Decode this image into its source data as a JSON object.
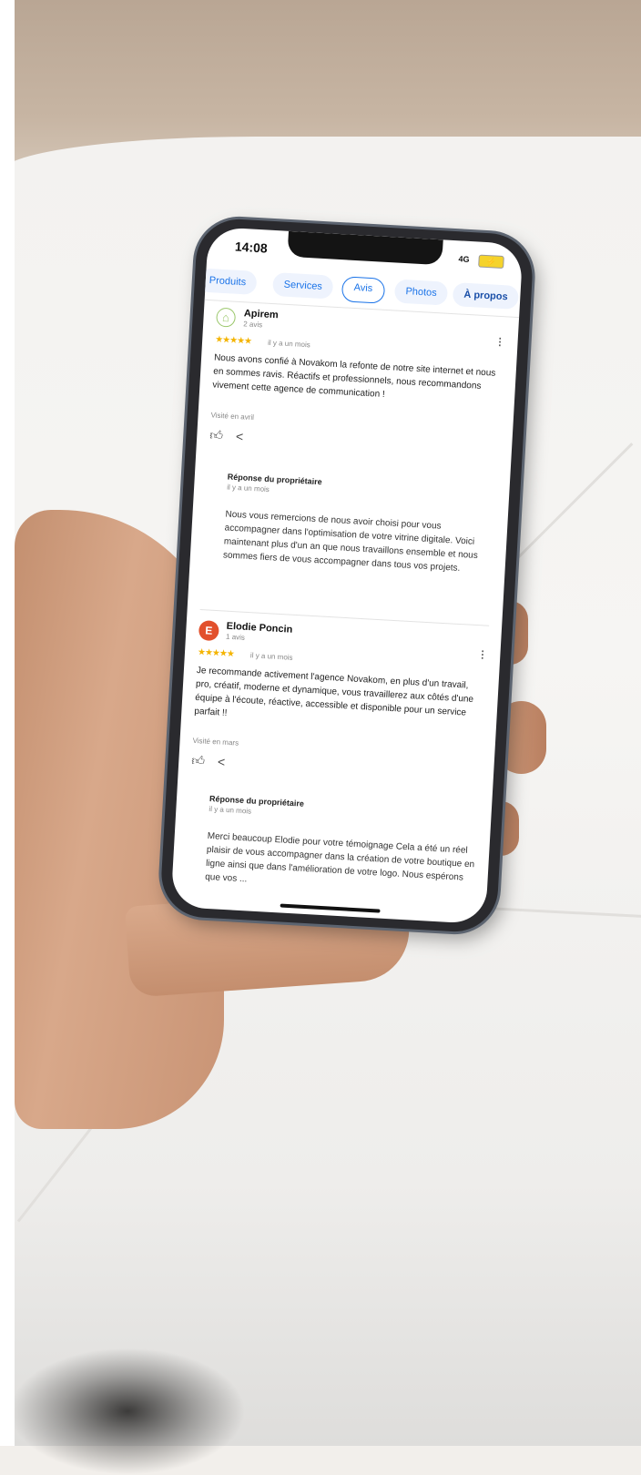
{
  "status": {
    "time": "14:08",
    "network": "4G"
  },
  "tabs": [
    {
      "label": "Produits"
    },
    {
      "label": "Services"
    },
    {
      "label": "Avis"
    },
    {
      "label": "Photos"
    },
    {
      "label": "À propos"
    }
  ],
  "reviews": [
    {
      "name": "Apirem",
      "count": "2 avis",
      "stars": "★★★★★",
      "when": "il y a un mois",
      "text": "Nous avons confié à Novakom la refonte de notre site internet et nous en sommes ravis. Réactifs et professionnels, nous recommandons vivement cette agence de communication !",
      "visited": "Visité en avril",
      "owner": {
        "title": "Réponse du propriétaire",
        "when": "il y a un mois",
        "text": "Nous vous remercions de nous avoir choisi pour vous accompagner dans l'optimisation de votre vitrine digitale. Voici maintenant plus d'un an que nous travaillons ensemble et nous sommes fiers de vous accompagner dans tous vos projets."
      }
    },
    {
      "initial": "E",
      "name": "Elodie Poncin",
      "count": "1 avis",
      "stars": "★★★★★",
      "when": "il y a un mois",
      "text": "Je recommande activement l'agence Novakom, en plus d'un travail, pro, créatif, moderne et dynamique, vous travaillerez aux côtés d'une équipe à l'écoute, réactive, accessible et disponible pour un service parfait !!",
      "visited": "Visité en mars",
      "owner": {
        "title": "Réponse du propriétaire",
        "when": "il y a un mois",
        "text": "Merci beaucoup Elodie pour votre témoignage Cela a été un réel plaisir de vous accompagner dans la création de votre boutique en ligne ainsi que dans l'amélioration de votre logo. Nous espérons que vos ..."
      }
    }
  ],
  "icons": {
    "like": "thumbs-up-icon",
    "share": "share-icon",
    "more": "kebab-icon"
  },
  "colors": {
    "link": "#1a73e8",
    "star": "#f4b400",
    "avatar": "#e2502c"
  }
}
